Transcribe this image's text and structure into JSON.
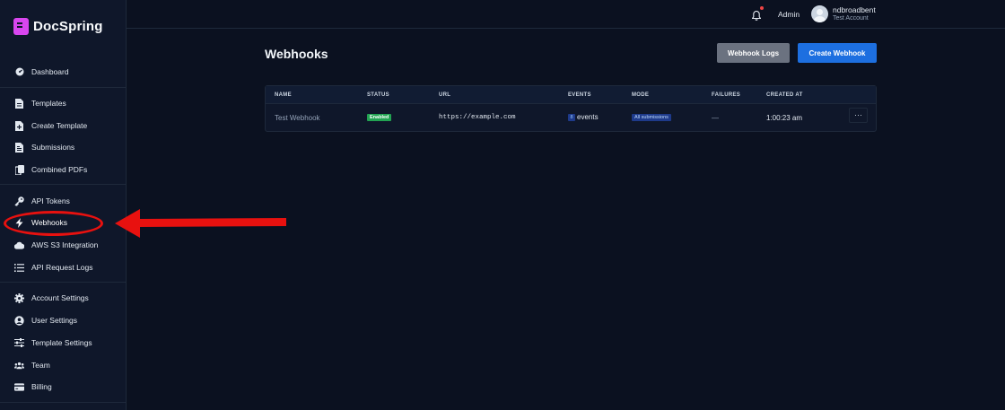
{
  "brand": {
    "name": "DocSpring"
  },
  "sidebar": {
    "items": [
      {
        "label": "Dashboard",
        "icon": "dashboard-icon"
      },
      {
        "label": "Templates",
        "icon": "file-icon"
      },
      {
        "label": "Create Template",
        "icon": "file-plus-icon"
      },
      {
        "label": "Submissions",
        "icon": "files-icon"
      },
      {
        "label": "Combined PDFs",
        "icon": "copy-icon"
      },
      {
        "label": "API Tokens",
        "icon": "key-icon"
      },
      {
        "label": "Webhooks",
        "icon": "bolt-icon"
      },
      {
        "label": "AWS S3 Integration",
        "icon": "cloud-icon"
      },
      {
        "label": "API Request Logs",
        "icon": "list-icon"
      },
      {
        "label": "Account Settings",
        "icon": "gear-icon"
      },
      {
        "label": "User Settings",
        "icon": "user-circle-icon"
      },
      {
        "label": "Template Settings",
        "icon": "sliders-icon"
      },
      {
        "label": "Team",
        "icon": "users-icon"
      },
      {
        "label": "Billing",
        "icon": "credit-card-icon"
      }
    ]
  },
  "header": {
    "admin_label": "Admin",
    "user_name": "ndbroadbent",
    "user_account": "Test Account"
  },
  "main": {
    "title": "Webhooks",
    "logs_button": "Webhook Logs",
    "create_button": "Create Webhook",
    "table": {
      "columns": [
        "NAME",
        "STATUS",
        "URL",
        "EVENTS",
        "MODE",
        "FAILURES",
        "CREATED AT"
      ],
      "rows": [
        {
          "name": "Test Webhook",
          "status": "Enabled",
          "url": "https://example.com",
          "events_count": "8",
          "events_label": "events",
          "mode": "All submissions",
          "failures": "—",
          "created_at": "1:00:23 am",
          "more": "···"
        }
      ]
    }
  },
  "colors": {
    "background": "#0b1120",
    "sidebar": "#0f172a",
    "accent_brand": "#d946ef",
    "primary_button": "#1d6fe0",
    "secondary_button": "#6b7280",
    "enabled_badge": "#22a352",
    "annotation": "#e8110f"
  }
}
